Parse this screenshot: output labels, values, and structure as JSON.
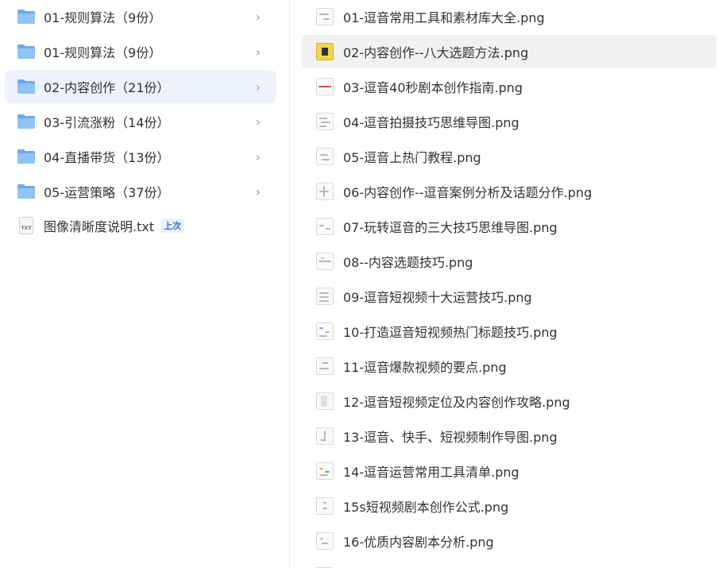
{
  "sidebar": {
    "folders": [
      {
        "label": "01-规则算法（9份）",
        "active": false
      },
      {
        "label": "01-规则算法（9份）",
        "active": false
      },
      {
        "label": "02-内容创作（21份）",
        "active": true
      },
      {
        "label": "03-引流涨粉（14份）",
        "active": false
      },
      {
        "label": "04-直播带货（13份）",
        "active": false
      },
      {
        "label": "05-运营策略（37份）",
        "active": false
      }
    ],
    "chevron": "›",
    "file": {
      "label": "图像清晰度说明.txt",
      "badge": "上次",
      "icon_text": "TXT"
    }
  },
  "files": [
    "01-逗音常用工具和素材库大全.png",
    "02-内容创作--八大选题方法.png",
    "03-逗音40秒剧本创作指南.png",
    "04-逗音拍摄技巧思维导图.png",
    "05-逗音上热门教程.png",
    "06-内容创作--逗音案例分析及话题分作.png",
    "07-玩转逗音的三大技巧思维导图.png",
    "08--内容选题技巧.png",
    "09-逗音短视频十大运营技巧.png",
    "10-打造逗音短视频热门标题技巧.png",
    "11-逗音爆款视频的要点.png",
    "12-逗音短视频定位及内容创作攻略.png",
    "13-逗音、快手、短视频制作导图.png",
    "14-逗音运营常用工具清单.png",
    "15s短视频剧本创作公式.png",
    "16-优质内容剧本分析.png"
  ],
  "colors": {
    "active_folder_bg": "#eef2fd",
    "active_row_bg": "#f1f1f2",
    "folder_icon": "#8ec4f6",
    "badge_text": "#2f6fe0"
  }
}
